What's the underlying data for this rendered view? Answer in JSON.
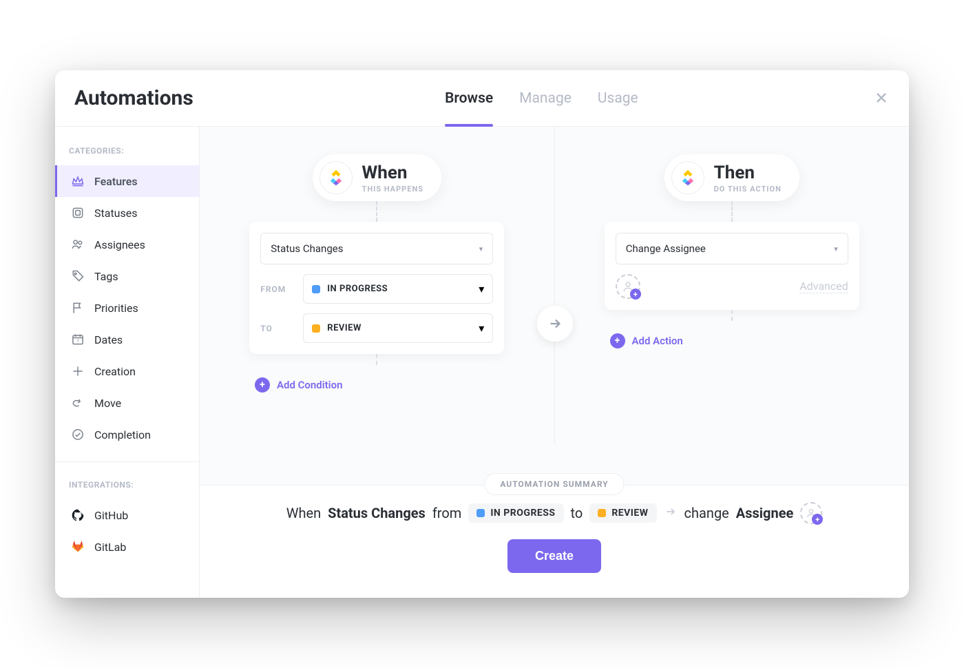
{
  "header": {
    "title": "Automations",
    "tabs": [
      {
        "label": "Browse",
        "active": true
      },
      {
        "label": "Manage",
        "active": false
      },
      {
        "label": "Usage",
        "active": false
      }
    ]
  },
  "sidebar": {
    "categories_title": "CATEGORIES:",
    "items": [
      {
        "label": "Features",
        "icon": "crown-icon",
        "active": true
      },
      {
        "label": "Statuses",
        "icon": "square-icon",
        "active": false
      },
      {
        "label": "Assignees",
        "icon": "users-icon",
        "active": false
      },
      {
        "label": "Tags",
        "icon": "tag-icon",
        "active": false
      },
      {
        "label": "Priorities",
        "icon": "flag-icon",
        "active": false
      },
      {
        "label": "Dates",
        "icon": "calendar-icon",
        "active": false
      },
      {
        "label": "Creation",
        "icon": "plus-icon",
        "active": false
      },
      {
        "label": "Move",
        "icon": "share-icon",
        "active": false
      },
      {
        "label": "Completion",
        "icon": "check-circle-icon",
        "active": false
      }
    ],
    "integrations_title": "INTEGRATIONS:",
    "integrations": [
      {
        "label": "GitHub",
        "icon": "github-icon"
      },
      {
        "label": "GitLab",
        "icon": "gitlab-icon"
      }
    ]
  },
  "when": {
    "title": "When",
    "subtitle": "THIS HAPPENS",
    "trigger_label": "Status Changes",
    "from_label": "FROM",
    "to_label": "TO",
    "from_status": {
      "label": "IN PROGRESS",
      "color": "#4f9cf9"
    },
    "to_status": {
      "label": "REVIEW",
      "color": "#fdb022"
    },
    "add_condition_label": "Add Condition"
  },
  "then": {
    "title": "Then",
    "subtitle": "DO THIS ACTION",
    "action_label": "Change Assignee",
    "advanced_label": "Advanced",
    "add_action_label": "Add Action"
  },
  "summary": {
    "badge": "AUTOMATION SUMMARY",
    "when_word": "When",
    "trigger": "Status Changes",
    "from_word": "from",
    "from_status": {
      "label": "IN PROGRESS",
      "color": "#4f9cf9"
    },
    "to_word": "to",
    "to_status": {
      "label": "REVIEW",
      "color": "#fdb022"
    },
    "change_word": "change",
    "what": "Assignee",
    "create_label": "Create"
  },
  "colors": {
    "primary": "#7b68ee"
  }
}
